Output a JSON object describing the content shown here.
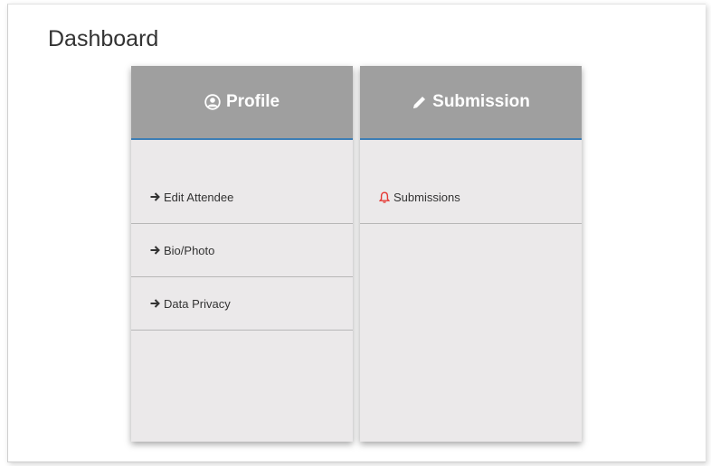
{
  "page": {
    "title": "Dashboard"
  },
  "colors": {
    "header_bg": "#9f9f9f",
    "header_accent": "#3d7eb5",
    "card_bg": "#ebe9ea",
    "bell": "#e53935"
  },
  "cards": [
    {
      "title": "Profile",
      "icon": "user-circle-icon",
      "items": [
        {
          "label": "Edit Attendee",
          "icon": "arrow-right-icon"
        },
        {
          "label": "Bio/Photo",
          "icon": "arrow-right-icon"
        },
        {
          "label": "Data Privacy",
          "icon": "arrow-right-icon"
        }
      ]
    },
    {
      "title": "Submission",
      "icon": "pencil-icon",
      "items": [
        {
          "label": "Submissions",
          "icon": "bell-icon"
        }
      ]
    }
  ]
}
